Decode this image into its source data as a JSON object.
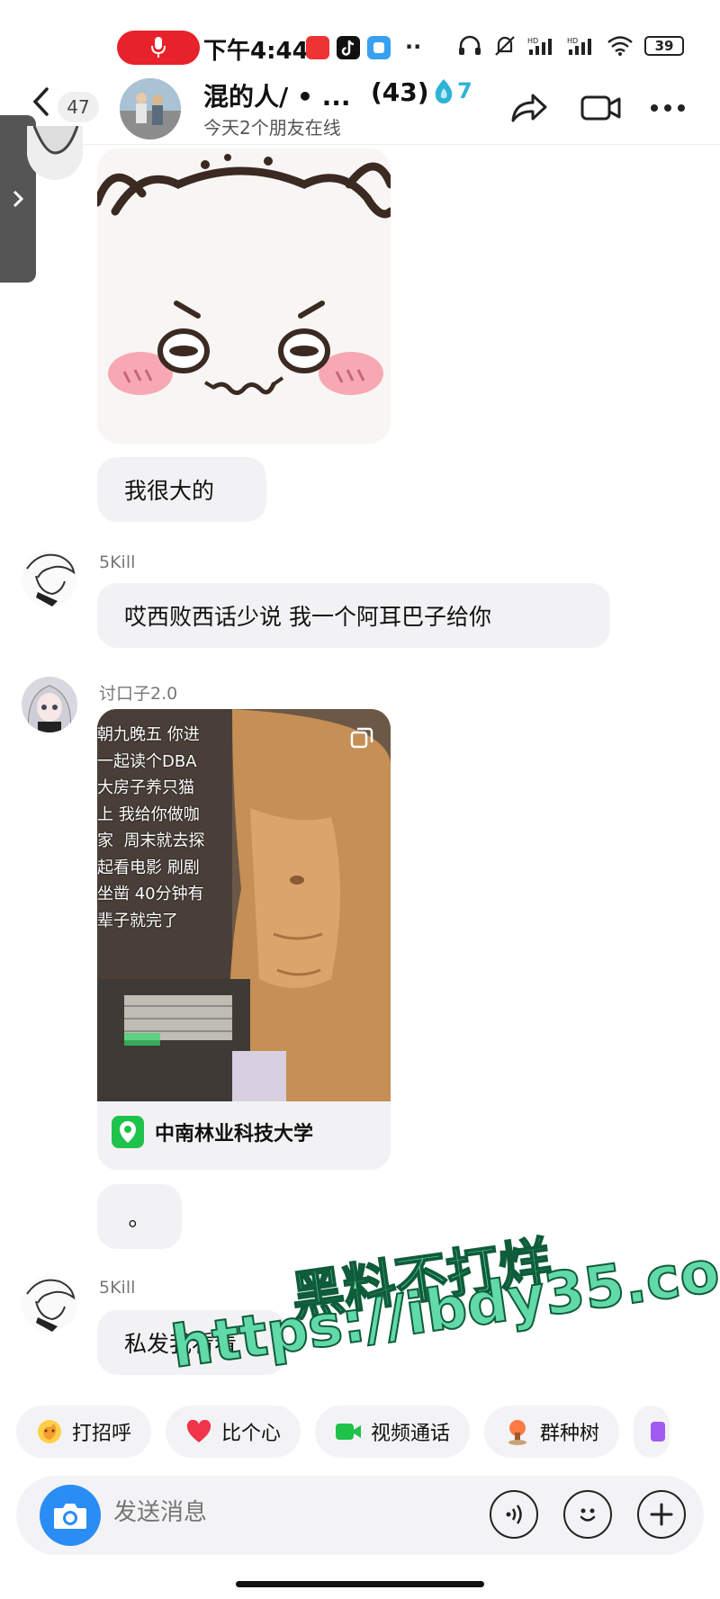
{
  "status_bar": {
    "time": "下午4:44",
    "battery": "39",
    "apps": [
      "recording-mic-icon",
      "red-app-icon",
      "tiktok-icon",
      "blue-app-icon"
    ],
    "more_dots": "··"
  },
  "header": {
    "back_count": "47",
    "group_name": "混的人/ • ...",
    "member_count": "(43)",
    "fire_count": "7",
    "subtitle": "今天2个朋友在线"
  },
  "messages": [
    {
      "type": "sticker",
      "description": "cartoon-face-sticker"
    },
    {
      "type": "text",
      "text": "我很大的"
    },
    {
      "type": "text",
      "sender": "5Kill",
      "text": "哎西败西话少说 我一个阿耳巴子给你"
    },
    {
      "type": "video",
      "sender": "讨口子2.0",
      "overlay_lines": [
        "朝九晚五 你进",
        "一起读个DBA",
        "大房子养只猫",
        "上 我给你做咖",
        "家  周末就去探",
        "起看电影 刷剧",
        "坐凿 40分钟有",
        "辈子就完了"
      ],
      "location": "中南林业科技大学"
    },
    {
      "type": "text",
      "text": "。"
    },
    {
      "type": "text",
      "sender": "5Kill",
      "text": "私发我看看"
    }
  ],
  "watermark": {
    "line1": "黑料不打烊",
    "line2": "https://ibdy35.com"
  },
  "quick_actions": [
    {
      "label": "打招呼",
      "icon": "wave-hand-icon"
    },
    {
      "label": "比个心",
      "icon": "heart-icon"
    },
    {
      "label": "视频通话",
      "icon": "video-call-icon"
    },
    {
      "label": "群种树",
      "icon": "tree-icon"
    }
  ],
  "input": {
    "placeholder": "发送消息"
  },
  "colors": {
    "accent_blue": "#2a8df5",
    "bubble_bg": "#f2f2f4",
    "record_red": "#e8222a",
    "watermark_green": "#62d9a8",
    "fire_blue": "#2db3d6"
  }
}
